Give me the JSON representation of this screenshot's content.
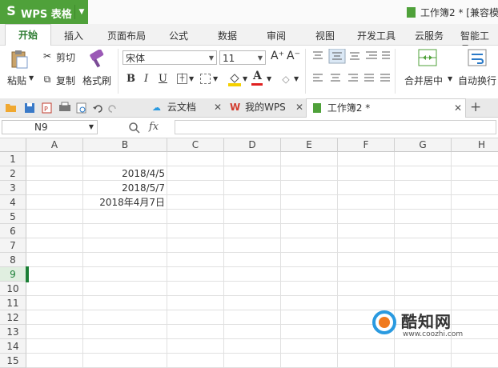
{
  "titlebar": {
    "logo": "S",
    "app_name": "WPS 表格",
    "document_title": "工作簿2 * [兼容模"
  },
  "menu_tabs": [
    "开始",
    "插入",
    "页面布局",
    "公式",
    "数据",
    "审阅",
    "视图",
    "开发工具",
    "云服务",
    "智能工具"
  ],
  "ribbon": {
    "paste": "粘贴",
    "cut": "剪切",
    "copy": "复制",
    "format_painter": "格式刷",
    "font_name": "宋体",
    "font_size": "11",
    "bold": "B",
    "italic": "I",
    "underline": "U",
    "increase_font": "A⁺",
    "decrease_font": "A⁻",
    "font_color_glyph": "A",
    "merge_center": "合并居中",
    "wrap_text": "自动换行"
  },
  "doc_tabs": {
    "tab1": "云文档",
    "tab2": "我的WPS",
    "tab3": "工作簿2 *",
    "new_tab": "+"
  },
  "formula_bar": {
    "name_box": "N9",
    "fx": "fx",
    "value": ""
  },
  "columns": [
    "A",
    "B",
    "C",
    "D",
    "E",
    "F",
    "G",
    "H"
  ],
  "rows": [
    "1",
    "2",
    "3",
    "4",
    "5",
    "6",
    "7",
    "8",
    "9",
    "10",
    "11",
    "12",
    "13",
    "14",
    "15"
  ],
  "cells": {
    "B2": "2018/4/5",
    "B3": "2018/5/7",
    "B4": "2018年4月7日"
  },
  "watermark": {
    "text": "酷知网",
    "url": "www.coozhi.com"
  },
  "colors": {
    "accent": "#4fa13a",
    "selection": "#1a7f35",
    "font_color": "#e02020",
    "fill_color": "#f5d000"
  }
}
